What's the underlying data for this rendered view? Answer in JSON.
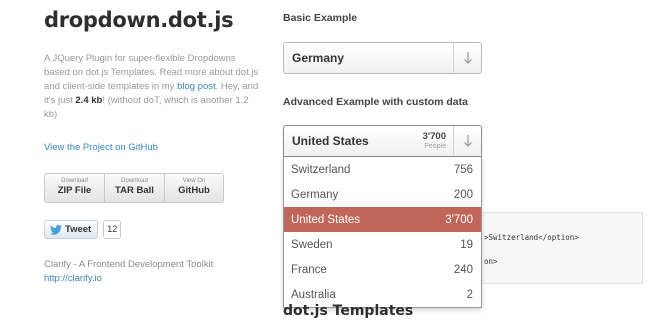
{
  "site": {
    "title": "dropdown.dot.js",
    "description": {
      "part1": "A JQuery Plugin for super-flexible Dropdowns based on dot.js Templates. Read more about dot.js and client-side templates in my ",
      "blog_link": "blog post",
      "part2": ". Hey, and it's just ",
      "size": "2.4 kb",
      "part3": "! (without doT, which is another 1.2 kb)"
    },
    "github_link": "View the Project on GitHub",
    "downloads": [
      {
        "small": "Download",
        "big": "ZIP File"
      },
      {
        "small": "Download",
        "big": "TAR Ball"
      },
      {
        "small": "View On",
        "big": "GitHub"
      }
    ],
    "tweet": {
      "label": "Tweet",
      "count": "12"
    },
    "clarify": {
      "text": "Clarify - A Frontend Development Toolkit",
      "link": "http://clarify.io"
    }
  },
  "basic_example": {
    "heading": "Basic Example",
    "selected": "Germany"
  },
  "advanced_example": {
    "heading": "Advanced Example with custom data",
    "selected": "United States",
    "selected_count": "3'700",
    "count_unit": "People",
    "options": [
      {
        "label": "Switzerland",
        "value": "756",
        "selected": false
      },
      {
        "label": "Germany",
        "value": "200",
        "selected": false
      },
      {
        "label": "United States",
        "value": "3'700",
        "selected": true
      },
      {
        "label": "Sweden",
        "value": "19",
        "selected": false
      },
      {
        "label": "France",
        "value": "240",
        "selected": false
      },
      {
        "label": "Australia",
        "value": "2",
        "selected": false
      }
    ]
  },
  "code": {
    "line1": ">Switzerland</option>",
    "line2": "on>"
  },
  "templates_heading": "dot.js Templates",
  "icons": {
    "arrow": "arrow-down-icon",
    "bird": "twitter-bird-icon"
  },
  "colors": {
    "accent": "#c1665a",
    "link": "#3b86c4"
  }
}
